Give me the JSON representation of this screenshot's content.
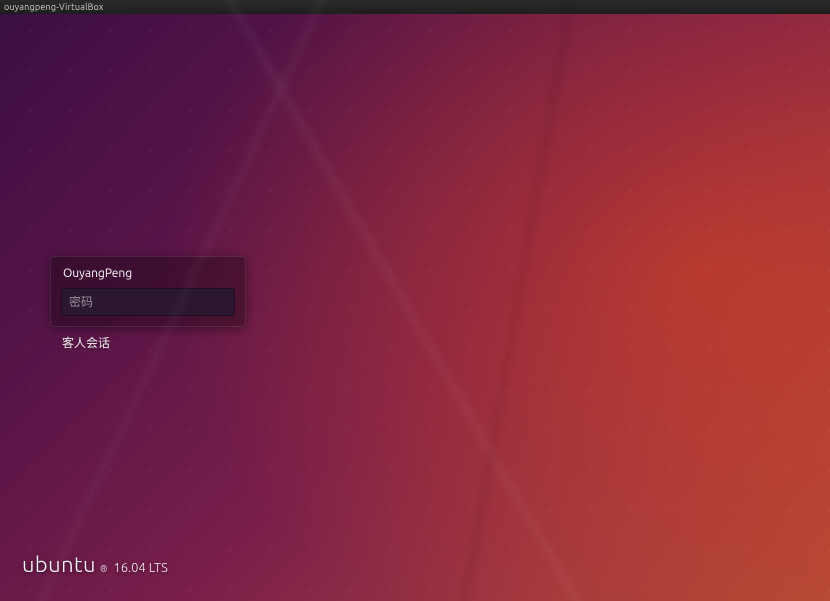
{
  "window": {
    "title": "ouyangpeng-VirtualBox"
  },
  "login": {
    "username": "OuyangPeng",
    "password_placeholder": "密码",
    "password_value": ""
  },
  "guest_session_label": "客人会话",
  "brand": {
    "name": "ubuntu",
    "registered": "®",
    "version": "16.04 LTS"
  }
}
